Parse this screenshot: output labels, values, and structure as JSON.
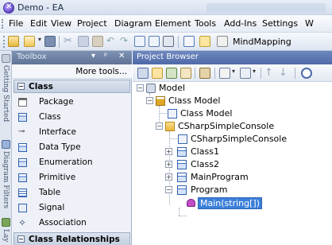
{
  "window": {
    "title": "Demo - EA"
  },
  "menu": [
    "File",
    "Edit",
    "View",
    "Project",
    "Diagram",
    "Element",
    "Tools",
    "Add-Ins",
    "Settings",
    "W"
  ],
  "toolbar": {
    "mindmapping_label": "MindMapping"
  },
  "side_tabs": [
    {
      "label": "Getting Started",
      "icon": "getting-started-icon"
    },
    {
      "label": "Diagram Filters",
      "icon": "diagram-filters-icon"
    },
    {
      "label": "Lay",
      "icon": "layout-icon"
    }
  ],
  "toolbox": {
    "title": "Toolbox",
    "controls": {
      "dropdown": "▾",
      "pin": "ᵖ",
      "close": "✕"
    },
    "more_tools": "More tools...",
    "groups": [
      {
        "label": "Class",
        "items": [
          {
            "label": "Package",
            "icon": "package-icon"
          },
          {
            "label": "Class",
            "icon": "class-icon"
          },
          {
            "label": "Interface",
            "icon": "interface-icon"
          },
          {
            "label": "Data Type",
            "icon": "datatype-icon"
          },
          {
            "label": "Enumeration",
            "icon": "enumeration-icon"
          },
          {
            "label": "Primitive",
            "icon": "primitive-icon"
          },
          {
            "label": "Table",
            "icon": "table-icon"
          },
          {
            "label": "Signal",
            "icon": "signal-icon"
          },
          {
            "label": "Association",
            "icon": "association-icon"
          }
        ]
      },
      {
        "label": "Class Relationships",
        "items": []
      }
    ]
  },
  "project_browser": {
    "title": "Project Browser",
    "tree": [
      {
        "label": "Model",
        "icon": "model-icon",
        "expander": "minus"
      },
      {
        "label": "Class Model",
        "icon": "package-icon",
        "expander": "minus"
      },
      {
        "label": "Class Model",
        "icon": "diagram-icon",
        "expander": ""
      },
      {
        "label": "CSharpSimpleConsole",
        "icon": "folder-icon",
        "expander": "minus"
      },
      {
        "label": "CSharpSimpleConsole",
        "icon": "diagram-icon",
        "expander": ""
      },
      {
        "label": "Class1",
        "icon": "class-icon",
        "expander": "plus"
      },
      {
        "label": "Class2",
        "icon": "class-icon",
        "expander": "plus"
      },
      {
        "label": "MainProgram",
        "icon": "class-icon",
        "expander": "plus"
      },
      {
        "label": "Program",
        "icon": "class-icon",
        "expander": "minus"
      },
      {
        "label": "Main(string[])",
        "icon": "operation-icon",
        "expander": "",
        "selected": true
      }
    ]
  }
}
